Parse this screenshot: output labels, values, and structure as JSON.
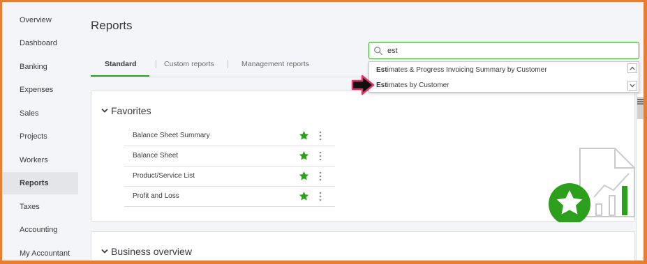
{
  "sidebar": {
    "items": [
      {
        "label": "Overview"
      },
      {
        "label": "Dashboard"
      },
      {
        "label": "Banking"
      },
      {
        "label": "Expenses"
      },
      {
        "label": "Sales"
      },
      {
        "label": "Projects"
      },
      {
        "label": "Workers"
      },
      {
        "label": "Reports",
        "active": true
      },
      {
        "label": "Taxes"
      },
      {
        "label": "Accounting"
      },
      {
        "label": "My Accountant"
      }
    ]
  },
  "page": {
    "title": "Reports"
  },
  "tabs": [
    {
      "label": "Standard",
      "active": true
    },
    {
      "label": "Custom reports"
    },
    {
      "label": "Management reports"
    }
  ],
  "search": {
    "value": "est",
    "results": [
      {
        "match": "Est",
        "rest": "imates & Progress Invoicing Summary by Customer"
      },
      {
        "match": "Est",
        "rest": "imates by Customer"
      }
    ]
  },
  "favorites": {
    "title": "Favorites",
    "items": [
      {
        "label": "Balance Sheet Summary"
      },
      {
        "label": "Balance Sheet"
      },
      {
        "label": "Product/Service List"
      },
      {
        "label": "Profit and Loss"
      }
    ]
  },
  "business_overview": {
    "title": "Business overview"
  },
  "colors": {
    "accent": "#2ca01c",
    "frame": "#e67e33",
    "pointer": "#e8336b"
  }
}
